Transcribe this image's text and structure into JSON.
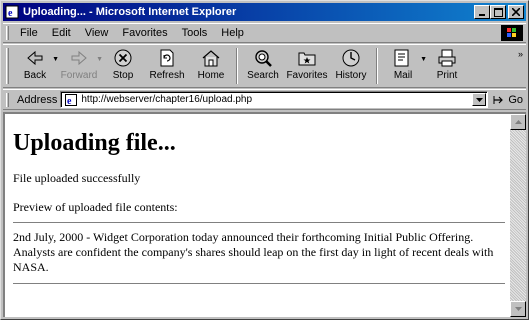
{
  "window": {
    "title": "Uploading... - Microsoft Internet Explorer",
    "controls": {
      "minimize": "_",
      "maximize": "□",
      "close": "✕"
    }
  },
  "menu": [
    {
      "label": "File"
    },
    {
      "label": "Edit"
    },
    {
      "label": "View"
    },
    {
      "label": "Favorites"
    },
    {
      "label": "Tools"
    },
    {
      "label": "Help"
    }
  ],
  "toolbar": {
    "back": "Back",
    "forward": "Forward",
    "stop": "Stop",
    "refresh": "Refresh",
    "home": "Home",
    "search": "Search",
    "favorites": "Favorites",
    "history": "History",
    "mail": "Mail",
    "print": "Print",
    "more": "»"
  },
  "address": {
    "label": "Address",
    "url": "http://webserver/chapter16/upload.php",
    "go_label": "Go"
  },
  "page": {
    "heading": "Uploading file...",
    "status": "File uploaded successfully",
    "preview_label": "Preview of uploaded file contents:",
    "file_contents": "2nd July, 2000 - Widget Corporation today announced their forthcoming Initial Public Offering. Analysts are confident the company's shares should leap on the first day in light of recent deals with NASA."
  },
  "colors": {
    "titlebar_start": "#000080",
    "titlebar_end": "#1084d0",
    "chrome": "#c0c0c0"
  },
  "icons": {
    "title": "ie-page-icon",
    "back": "back-arrow-icon",
    "forward": "forward-arrow-icon",
    "stop": "stop-icon",
    "refresh": "refresh-icon",
    "home": "home-icon",
    "search": "search-icon",
    "favorites": "favorites-icon",
    "history": "history-icon",
    "mail": "mail-icon",
    "print": "print-icon",
    "go": "go-arrow-icon"
  }
}
